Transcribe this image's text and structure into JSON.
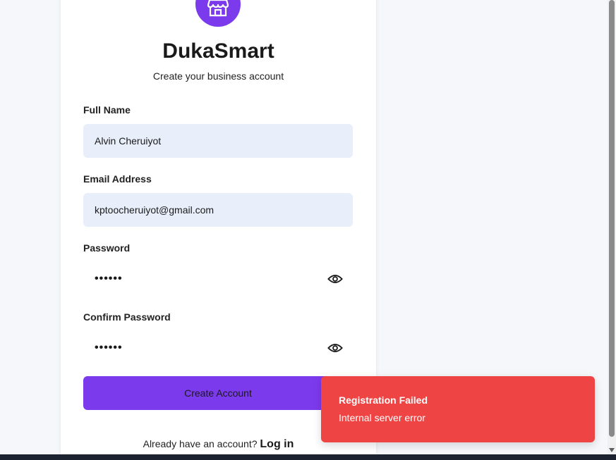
{
  "brand": {
    "name": "DukaSmart",
    "subtitle": "Create your business account",
    "logo_icon": "storefront-icon",
    "accent_color": "#7c3aed"
  },
  "form": {
    "full_name": {
      "label": "Full Name",
      "value": "Alvin Cheruiyot"
    },
    "email": {
      "label": "Email Address",
      "value": "kptoocheruiyot@gmail.com"
    },
    "password": {
      "label": "Password",
      "value": "••••••",
      "toggle_icon": "eye-icon"
    },
    "confirm_password": {
      "label": "Confirm Password",
      "value": "••••••",
      "toggle_icon": "eye-icon"
    },
    "submit_label": "Create Account"
  },
  "footer": {
    "prompt": "Already have an account?",
    "link_label": "Log in"
  },
  "toast": {
    "title": "Registration Failed",
    "message": "Internal server error",
    "color": "#ef4444"
  }
}
